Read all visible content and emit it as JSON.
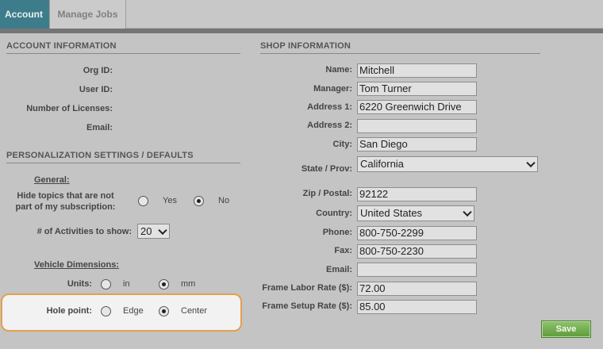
{
  "tabs": [
    {
      "label": "Account"
    },
    {
      "label": "Manage Jobs"
    }
  ],
  "account": {
    "title": "ACCOUNT INFORMATION",
    "org_id_label": "Org ID:",
    "user_id_label": "User ID:",
    "licenses_label": "Number of Licenses:",
    "email_label": "Email:"
  },
  "personalization": {
    "title": "PERSONALIZATION SETTINGS / DEFAULTS",
    "general_label": "General:",
    "hide_topics_label_line1": "Hide topics that are not",
    "hide_topics_label_line2": "part of my subscription:",
    "yes_label": "Yes",
    "no_label": "No",
    "hide_topics_value": "No",
    "activities_label": "# of Activities to show:",
    "activities_value": "20",
    "vehicle_label": "Vehicle Dimensions:",
    "units_label": "Units:",
    "in_label": "in",
    "mm_label": "mm",
    "units_value": "mm",
    "hole_point_label": "Hole point:",
    "edge_label": "Edge",
    "center_label": "Center",
    "hole_point_value": "Center"
  },
  "shop": {
    "title": "SHOP INFORMATION",
    "name_label": "Name:",
    "name_value": "Mitchell",
    "manager_label": "Manager:",
    "manager_value": "Tom Turner",
    "address1_label": "Address 1:",
    "address1_value": "6220 Greenwich Drive",
    "address2_label": "Address 2:",
    "address2_value": "",
    "city_label": "City:",
    "city_value": "San Diego",
    "state_label": "State / Prov:",
    "state_value": "California",
    "zip_label": "Zip / Postal:",
    "zip_value": "92122",
    "country_label": "Country:",
    "country_value": "United States",
    "phone_label": "Phone:",
    "phone_value": "800-750-2299",
    "fax_label": "Fax:",
    "fax_value": "800-750-2230",
    "email_label": "Email:",
    "email_value": "",
    "labor_rate_label": "Frame Labor Rate ($):",
    "labor_rate_value": "72.00",
    "setup_rate_label": "Frame Setup Rate ($):",
    "setup_rate_value": "85.00"
  },
  "save_label": "Save",
  "colors": {
    "active_tab": "#3d7c8a",
    "highlight_border": "#e3a04c",
    "save_button": "#6aa746"
  }
}
